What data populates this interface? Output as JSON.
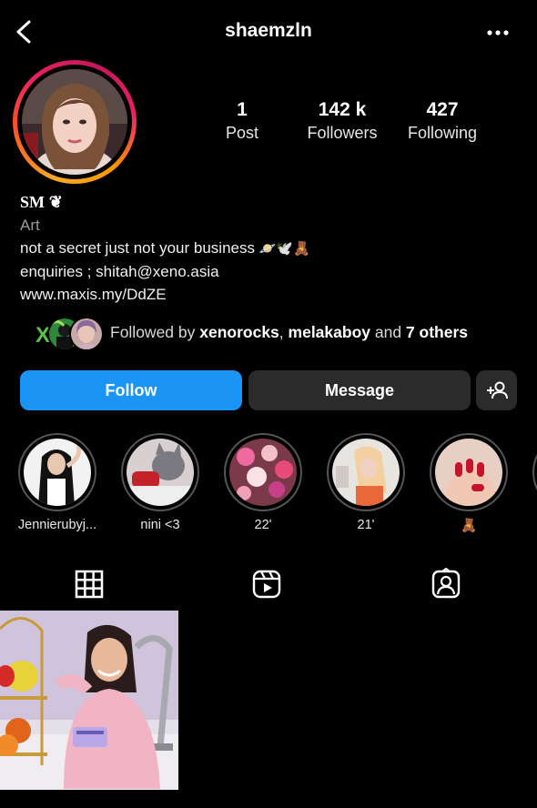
{
  "header": {
    "username": "shaemzln",
    "back_icon": "chevron-left-icon",
    "more_icon": "ellipsis-icon"
  },
  "stats": [
    {
      "value": "1",
      "label": "Post"
    },
    {
      "value": "142 k",
      "label": "Followers"
    },
    {
      "value": "427",
      "label": "Following"
    }
  ],
  "bio": {
    "name": "SM",
    "name_emoji": "❦",
    "category": "Art",
    "line1": "not a secret just not your business",
    "line1_emojis": "🪐🕊️🧸",
    "line2": "enquiries ; shitah@xeno.asia",
    "link": "www.maxis.my/DdZE"
  },
  "followed_by": {
    "prefix": "Followed by ",
    "user1": "xenorocks",
    "sep": ", ",
    "user2": "melakaboy",
    "and": " and ",
    "others": "7 others",
    "x_badge": "X"
  },
  "buttons": {
    "follow": "Follow",
    "message": "Message",
    "add_user_icon": "add-person-icon"
  },
  "highlights": [
    {
      "label": "Jennierubyj..."
    },
    {
      "label": "nini <3"
    },
    {
      "label": "22'"
    },
    {
      "label": "21'"
    },
    {
      "label": "🧸"
    }
  ],
  "tabs": [
    {
      "icon": "grid-icon"
    },
    {
      "icon": "reels-icon"
    },
    {
      "icon": "tagged-icon"
    }
  ],
  "colors": {
    "follow": "#1a94f5",
    "secondary_button": "#2b2b2b",
    "background": "#000000"
  }
}
